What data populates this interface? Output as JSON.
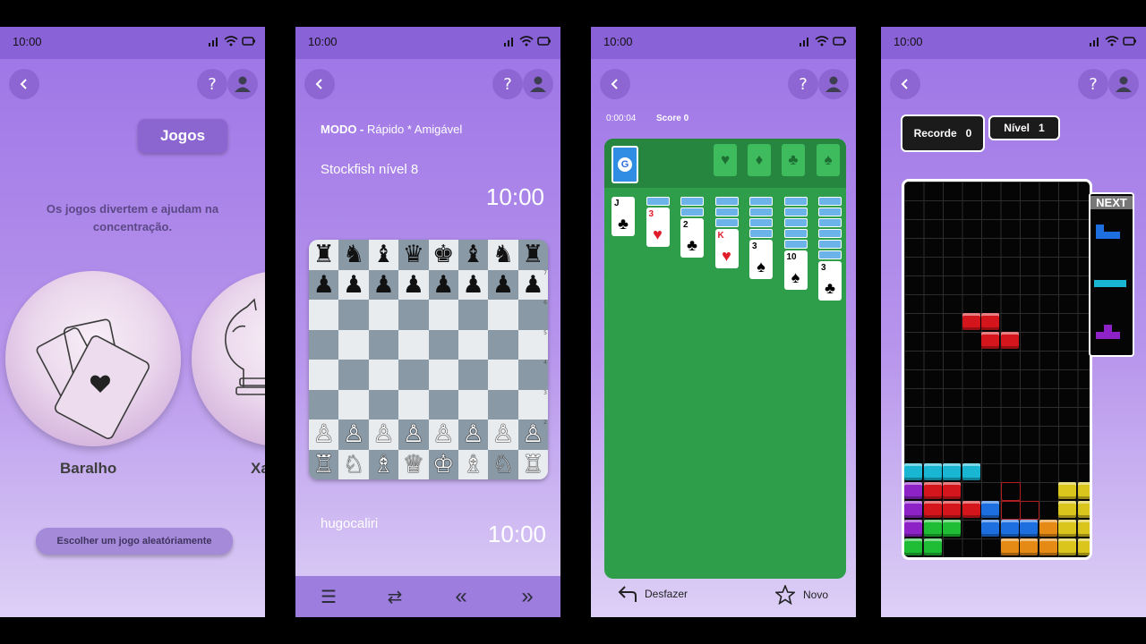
{
  "status": {
    "time": "10:00"
  },
  "phone1": {
    "title": "Jogos",
    "description": "Os jogos divertem e ajudam na concentração.",
    "games": [
      {
        "label": "Baralho"
      },
      {
        "label": "Xa"
      }
    ],
    "random_button": "Escolher um jogo aleatóriamente",
    "icons": [
      "back-arrow-icon",
      "help-icon",
      "user-icon",
      "cards-icon",
      "chess-knight-icon"
    ]
  },
  "phone2": {
    "mode_label": "MODO -",
    "mode_value": "Rápido * Amigável",
    "opponent": "Stockfish nível 8",
    "opponent_time": "10:00",
    "player": "hugocaliri",
    "player_time": "10:00",
    "rank_numbers": [
      "7",
      "6",
      "5",
      "4",
      "3",
      "2"
    ],
    "board": [
      [
        "♜",
        "♞",
        "♝",
        "♛",
        "♚",
        "♝",
        "♞",
        "♜"
      ],
      [
        "♟",
        "♟",
        "♟",
        "♟",
        "♟",
        "♟",
        "♟",
        "♟"
      ],
      [
        "",
        "",
        "",
        "",
        "",
        "",
        "",
        ""
      ],
      [
        "",
        "",
        "",
        "",
        "",
        "",
        "",
        ""
      ],
      [
        "",
        "",
        "",
        "",
        "",
        "",
        "",
        ""
      ],
      [
        "",
        "",
        "",
        "",
        "",
        "",
        "",
        ""
      ],
      [
        "♙",
        "♙",
        "♙",
        "♙",
        "♙",
        "♙",
        "♙",
        "♙"
      ],
      [
        "♖",
        "♘",
        "♗",
        "♕",
        "♔",
        "♗",
        "♘",
        "♖"
      ]
    ],
    "bottom_icons": [
      "menu-icon",
      "flip-board-icon",
      "rewind-icon",
      "fast-forward-icon"
    ],
    "bottom_glyphs": [
      "☰",
      "⇄",
      "«",
      "»"
    ]
  },
  "phone3": {
    "timer": "0:00:04",
    "score": "Score 0",
    "stock_label": "G",
    "foundation_suits": [
      "♥",
      "♦",
      "♣",
      "♠"
    ],
    "piles": [
      {
        "down": 0,
        "rank": "J",
        "suit": "♣",
        "red": false
      },
      {
        "down": 1,
        "rank": "3",
        "suit": "♥",
        "red": true
      },
      {
        "down": 2,
        "rank": "2",
        "suit": "♣",
        "red": false
      },
      {
        "down": 3,
        "rank": "K",
        "suit": "♥",
        "red": true
      },
      {
        "down": 4,
        "rank": "3",
        "suit": "♠",
        "red": false
      },
      {
        "down": 5,
        "rank": "10",
        "suit": "♠",
        "red": false
      },
      {
        "down": 6,
        "rank": "3",
        "suit": "♣",
        "red": false
      }
    ],
    "undo_label": "Desfazer",
    "new_label": "Novo"
  },
  "phone4": {
    "record_label": "Recorde",
    "record_value": "0",
    "level_label": "Nível",
    "level_value": "1",
    "next_label": "NEXT",
    "colors": {
      "red": "#d4151b",
      "cyan": "#19b6d4",
      "purple": "#8d23c6",
      "blue": "#1d6fe0",
      "green": "#1fbd35",
      "yellow": "#d9c51c",
      "orange": "#e58a15"
    }
  }
}
